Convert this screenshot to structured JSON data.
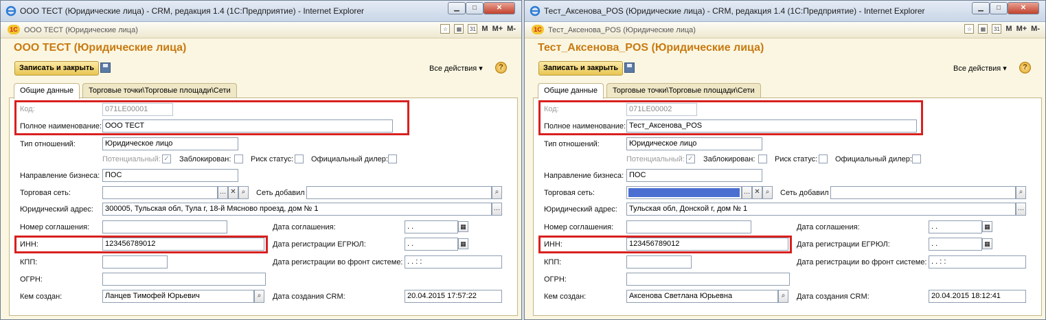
{
  "windows": [
    {
      "ie_title": "ООО ТЕСТ (Юридические лица) - CRM, редакция 1.4 (1С:Предприятие) - Internet Explorer",
      "toolbar_title": "ООО ТЕСТ (Юридические лица)",
      "form_title": "ООО ТЕСТ (Юридические лица)",
      "fields": {
        "code": "071LE00001",
        "full_name": "ООО ТЕСТ",
        "relation_type": "Юридическое лицо",
        "business_direction": "ПОС",
        "trade_network": "",
        "legal_address": "300005, Тульская обл, Тула г, 18-й Мясново проезд, дом № 1",
        "agreement_number": "",
        "agreement_date": " .  .",
        "inn": "123456789012",
        "egrul_date": " .  .",
        "kpp": "",
        "front_date": " .  .      :  :",
        "ogrn": "",
        "created_by": "Ланцев Тимофей Юрьевич",
        "crm_created": "20.04.2015 17:57:22"
      }
    },
    {
      "ie_title": "Тест_Аксенова_POS (Юридические лица) - CRM, редакция 1.4 (1С:Предприятие) - Internet Explorer",
      "toolbar_title": "Тест_Аксенова_POS (Юридические лица)",
      "form_title": "Тест_Аксенова_POS (Юридические лица)",
      "fields": {
        "code": "071LE00002",
        "full_name": "Тест_Аксенова_POS",
        "relation_type": "Юридическое лицо",
        "business_direction": "ПОС",
        "trade_network": "",
        "legal_address": "Тульская обл, Донской г, дом № 1",
        "agreement_number": "",
        "agreement_date": " .  .",
        "inn": "123456789012",
        "egrul_date": " .  .",
        "kpp": "",
        "front_date": " .  .      :  :",
        "ogrn": "",
        "created_by": "Аксенова Светлана Юрьевна",
        "crm_created": "20.04.2015 18:12:41"
      }
    }
  ],
  "labels": {
    "save_close": "Записать и закрыть",
    "all_actions": "Все действия",
    "tab_general": "Общие данные",
    "tab_trade": "Торговые точки\\Торговые площади\\Сети",
    "code": "Код:",
    "full_name": "Полное наименование:",
    "relation_type": "Тип отношений:",
    "potential": "Потенциальный:",
    "blocked": "Заблокирован:",
    "risk_status": "Риск статус:",
    "official_dealer": "Официальный дилер:",
    "business_direction": "Направление бизнеса:",
    "trade_network": "Торговая сеть:",
    "network_added": "Сеть добавил",
    "legal_address": "Юридический адрес:",
    "agreement_number": "Номер соглашения:",
    "agreement_date": "Дата соглашения:",
    "inn": "ИНН:",
    "egrul_date": "Дата регистрации ЕГРЮЛ:",
    "kpp": "КПП:",
    "front_date": "Дата регистрации во фронт системе:",
    "ogrn": "ОГРН:",
    "created_by": "Кем создан:",
    "crm_created": "Дата создания CRM:"
  },
  "toolbar_letters": {
    "m": "M",
    "mplus": "M+",
    "mminus": "M-"
  },
  "colors": {
    "title_orange": "#c87a10",
    "highlight_red": "#d8201e",
    "network_fill": "#4a6fd1"
  },
  "checkboxes": {
    "potential_checked": true,
    "blocked": false,
    "risk": false,
    "dealer": false
  },
  "icons": [
    "ie-icon",
    "1c-logo-icon",
    "floppy-icon",
    "help-icon",
    "calendar-icon",
    "search-icon",
    "ellipsis-icon",
    "clear-icon"
  ]
}
